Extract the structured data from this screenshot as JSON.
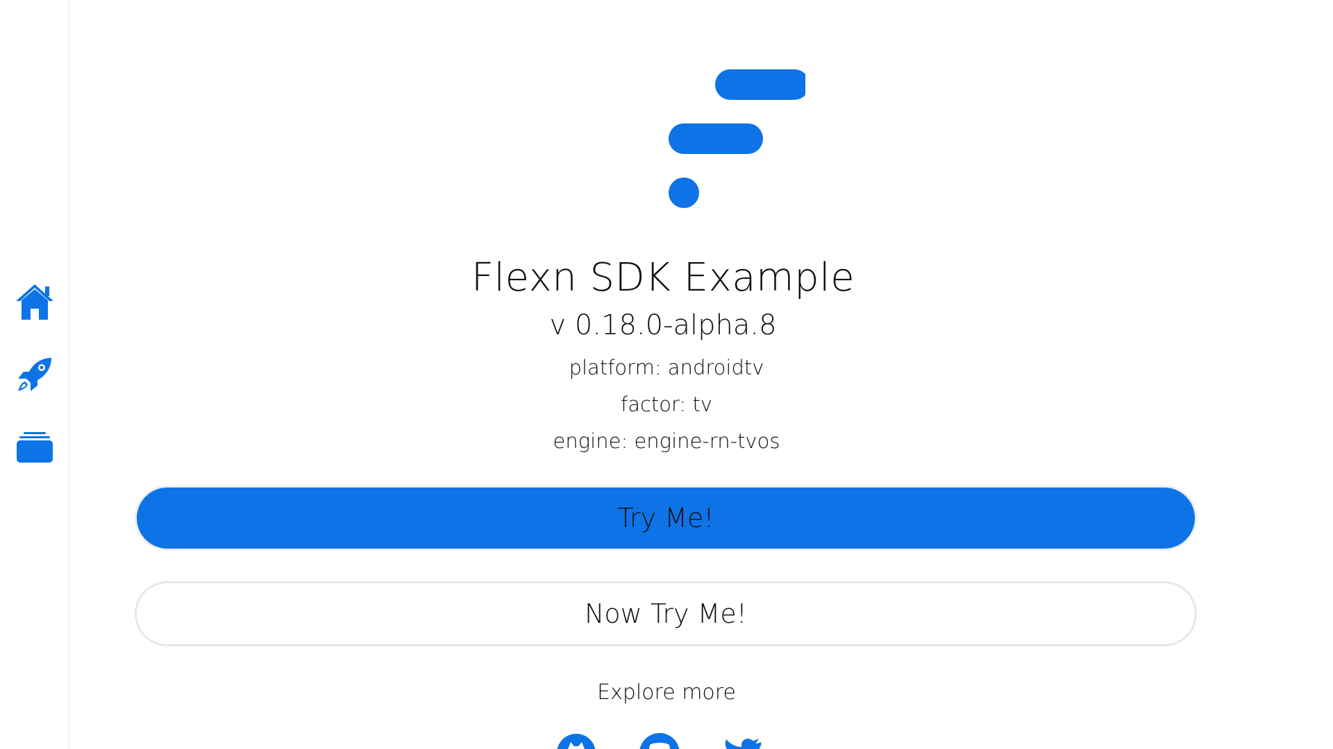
{
  "sidebar": {
    "items": [
      {
        "name": "home",
        "icon": "home-icon"
      },
      {
        "name": "rocket",
        "icon": "rocket-icon"
      },
      {
        "name": "stack",
        "icon": "stack-icon"
      }
    ]
  },
  "app": {
    "logo_icon": "flexn-logo",
    "title": "Flexn SDK Example",
    "version": "v 0.18.0-alpha.8",
    "platform": "platform: androidtv",
    "factor": "factor: tv",
    "engine": "engine: engine-rn-tvos"
  },
  "buttons": {
    "try_me": "Try Me!",
    "now_try_me": "Now Try Me!"
  },
  "explore": {
    "label": "Explore more",
    "links": [
      {
        "icon": "github-icon"
      },
      {
        "icon": "discord-icon"
      },
      {
        "icon": "twitter-icon"
      }
    ]
  },
  "colors": {
    "accent": "#0d73e6",
    "text": "#111111",
    "border": "#e8e8e8"
  }
}
